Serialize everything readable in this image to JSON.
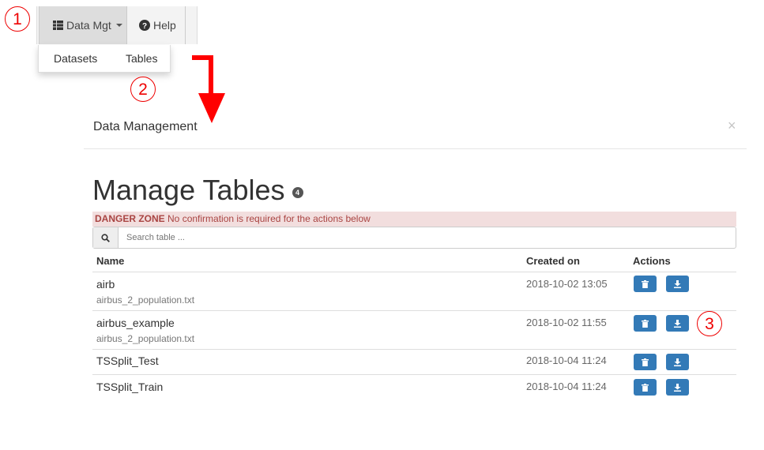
{
  "annotations": [
    "1",
    "2",
    "3"
  ],
  "navbar": {
    "data_mgt_label": "Data Mgt",
    "help_label": "Help",
    "dropdown_items": [
      "Datasets",
      "Tables"
    ]
  },
  "modal": {
    "title": "Data Management",
    "close": "×",
    "heading": "Manage Tables",
    "count": "4",
    "danger_label": "DANGER ZONE",
    "danger_text": "No confirmation is required for the actions below",
    "search_placeholder": "Search table ...",
    "columns": [
      "Name",
      "Created on",
      "Actions"
    ],
    "rows": [
      {
        "name": "airb",
        "file": "airbus_2_population.txt",
        "created": "2018-10-02 13:05"
      },
      {
        "name": "airbus_example",
        "file": "airbus_2_population.txt",
        "created": "2018-10-02 11:55"
      },
      {
        "name": "TSSplit_Test",
        "file": "",
        "created": "2018-10-04 11:24"
      },
      {
        "name": "TSSplit_Train",
        "file": "",
        "created": "2018-10-04 11:24"
      }
    ]
  },
  "colors": {
    "annotation": "#e00000",
    "arrow": "#ff0000",
    "primary_button": "#337ab7",
    "danger_bg": "#f2dede"
  },
  "icons": [
    "table-icon",
    "help-circle-icon",
    "search-icon",
    "trash-icon",
    "download-icon",
    "close-icon",
    "red-arrow"
  ]
}
